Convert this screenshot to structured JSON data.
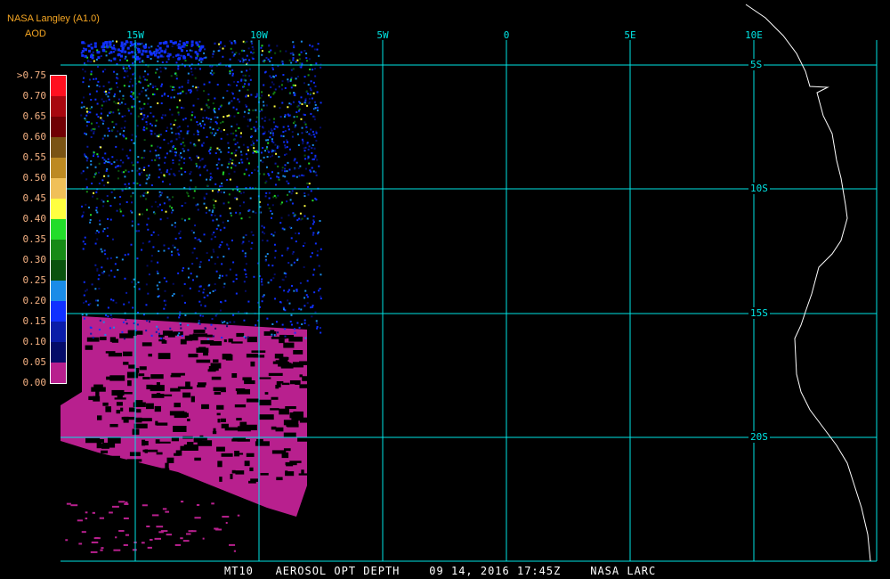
{
  "header": {
    "title": "NASA Langley (A1.0)",
    "subtitle": "AOD"
  },
  "legend": {
    "labels": [
      ">0.75",
      "0.70",
      "0.65",
      "0.60",
      "0.55",
      "0.50",
      "0.45",
      "0.40",
      "0.35",
      "0.30",
      "0.25",
      "0.20",
      "0.15",
      "0.10",
      "0.05",
      "0.00"
    ],
    "colors": [
      "#ff1020",
      "#a8070f",
      "#700004",
      "#7a5414",
      "#bd8a22",
      "#f0c058",
      "#ffff40",
      "#22dd2a",
      "#168a16",
      "#0a520e",
      "#1a8ce8",
      "#1030ff",
      "#0a1ca8",
      "#050c68",
      "#b8208e"
    ]
  },
  "map": {
    "lon_labels": [
      "15W",
      "10W",
      "5W",
      "0",
      "5E",
      "10E"
    ],
    "lat_labels": [
      "5S",
      "10S",
      "15S",
      "20S"
    ],
    "grid_color": "#00e5e5",
    "coast_color": "#ffffff"
  },
  "footer": {
    "text": "MT10   AEROSOL OPT DEPTH    09 14, 2016 17:45Z    NASA LARC"
  }
}
